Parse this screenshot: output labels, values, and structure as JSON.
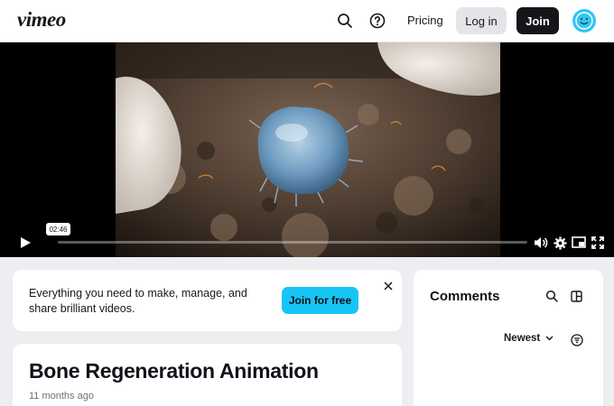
{
  "brand": {
    "logo_text": "vimeo"
  },
  "header": {
    "search_icon": "search-icon",
    "help_icon": "help-icon",
    "pricing_label": "Pricing",
    "login_label": "Log in",
    "join_label": "Join",
    "avatar_icon": "smiley-icon"
  },
  "player": {
    "current_time": "02:46",
    "progress": 0.0,
    "controls": [
      "play-icon",
      "volume-icon",
      "settings-icon",
      "pip-icon",
      "fullscreen-icon"
    ]
  },
  "banner": {
    "text": "Everything you need to make, manage, and share brilliant videos.",
    "cta_label": "Join for free",
    "close_icon": "close-icon"
  },
  "video": {
    "title": "Bone Regeneration Animation",
    "age": "11 months ago"
  },
  "comments": {
    "title": "Comments",
    "sort_label": "Newest",
    "icons": [
      "search-icon",
      "panel-toggle-icon",
      "filter-icon"
    ]
  },
  "colors": {
    "accent": "#17c5f5",
    "header_bg": "#ffffff",
    "page_bg": "#eceef1",
    "dark_button": "#141619"
  }
}
